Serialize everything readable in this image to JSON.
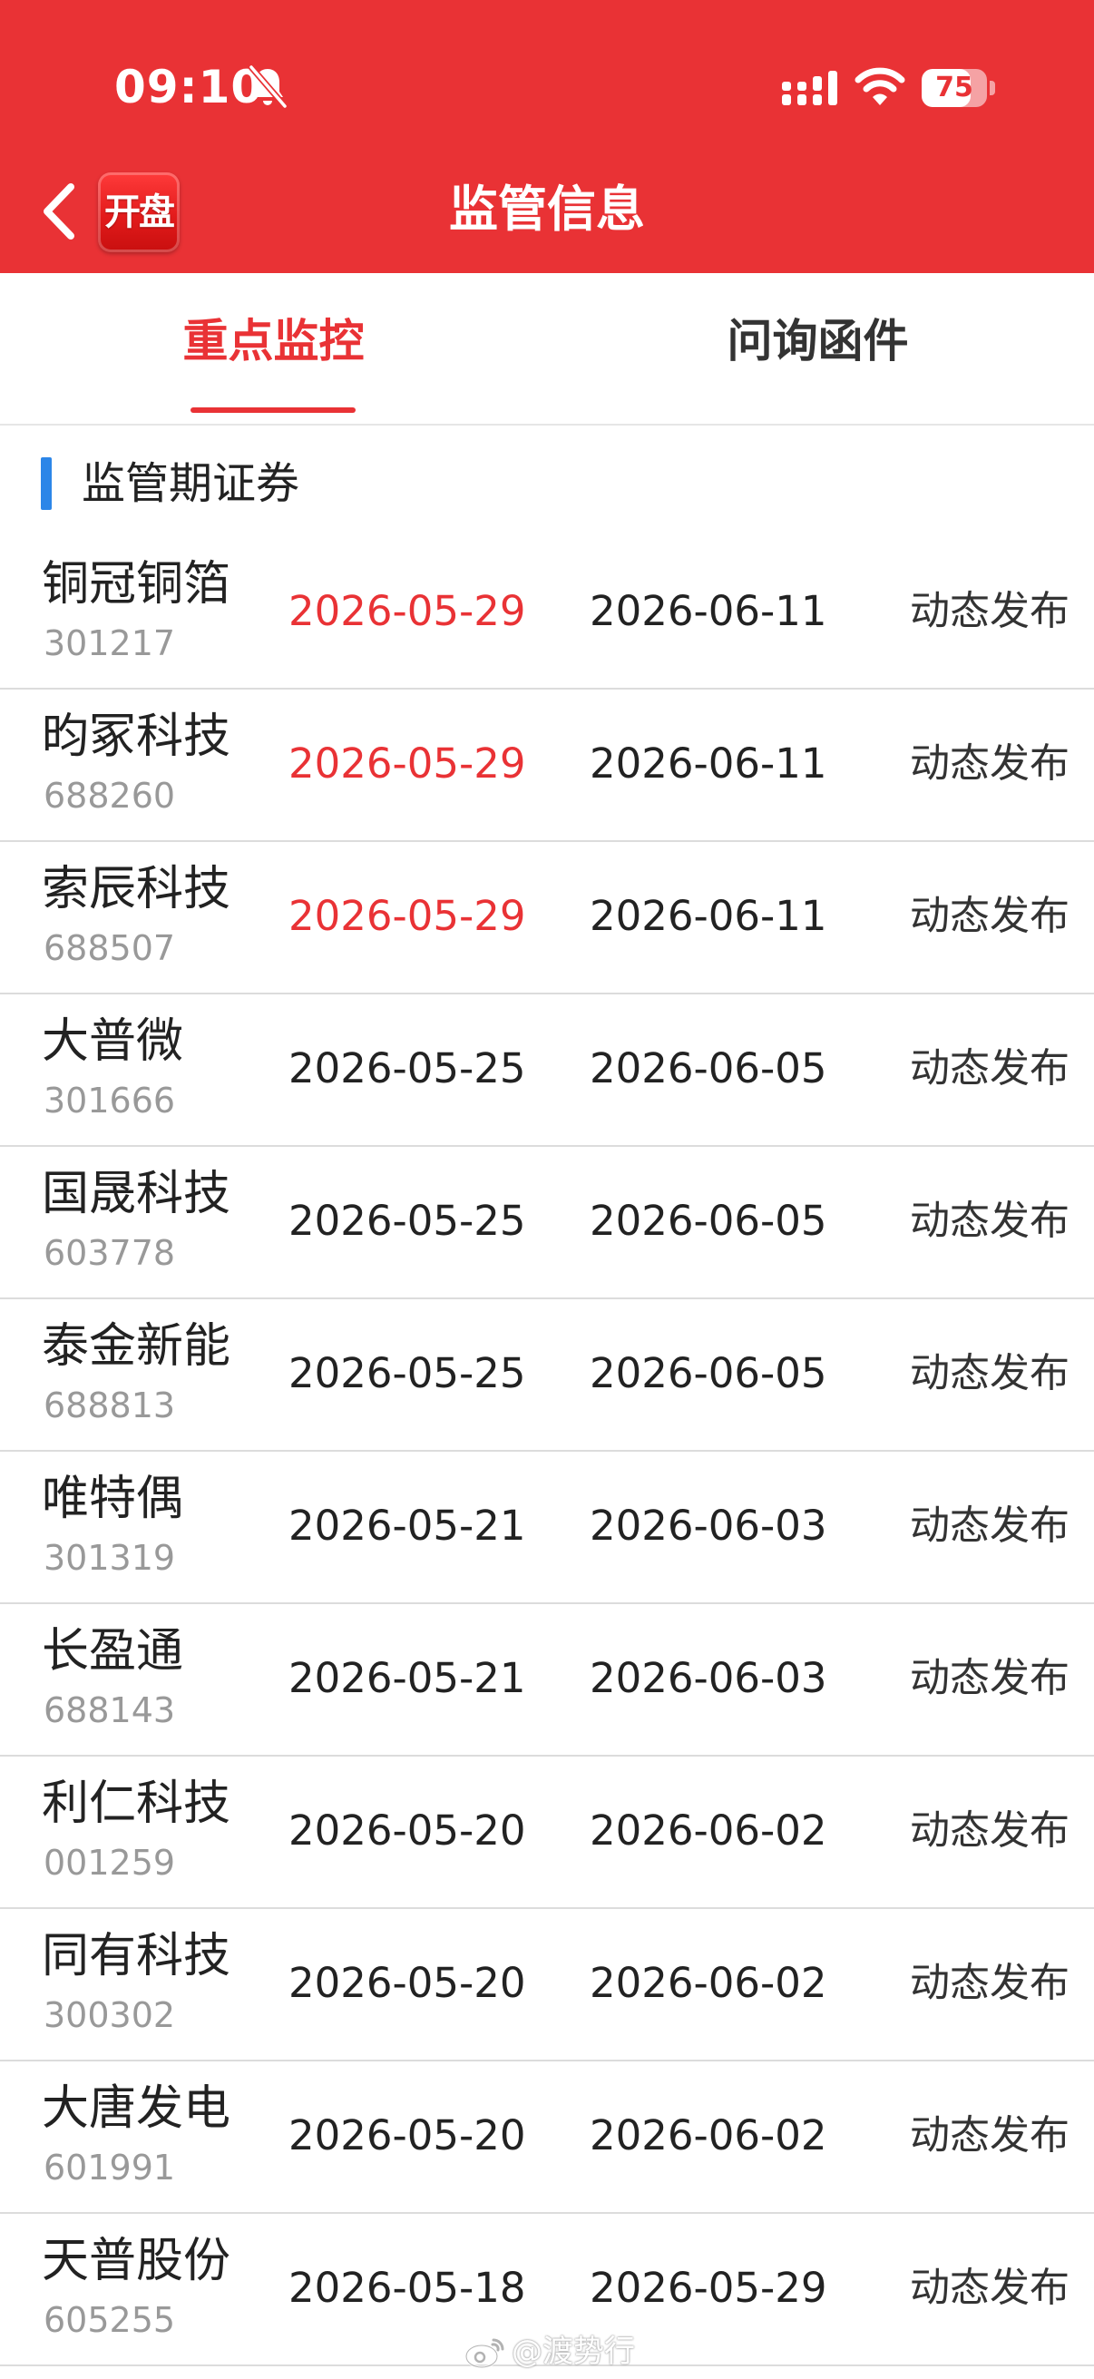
{
  "status_bar": {
    "time": "09:10",
    "battery": "75",
    "battery_level": 0.75,
    "icons": [
      "bell-slash-icon",
      "signal-icon",
      "wifi-icon",
      "battery-icon"
    ]
  },
  "nav": {
    "back_icon": "chevron-left-icon",
    "logo_text": "开盘",
    "title": "监管信息"
  },
  "tabs": [
    {
      "label": "重点监控",
      "active": true
    },
    {
      "label": "问询函件",
      "active": false
    }
  ],
  "section": {
    "title": "监管期证券"
  },
  "rows": [
    {
      "name": "铜冠铜箔",
      "code": "301217",
      "start": "2026-05-29",
      "end": "2026-06-11",
      "action": "动态发布",
      "start_highlight": true
    },
    {
      "name": "昀冢科技",
      "code": "688260",
      "start": "2026-05-29",
      "end": "2026-06-11",
      "action": "动态发布",
      "start_highlight": true
    },
    {
      "name": "索辰科技",
      "code": "688507",
      "start": "2026-05-29",
      "end": "2026-06-11",
      "action": "动态发布",
      "start_highlight": true
    },
    {
      "name": "大普微",
      "code": "301666",
      "start": "2026-05-25",
      "end": "2026-06-05",
      "action": "动态发布",
      "start_highlight": false
    },
    {
      "name": "国晟科技",
      "code": "603778",
      "start": "2026-05-25",
      "end": "2026-06-05",
      "action": "动态发布",
      "start_highlight": false
    },
    {
      "name": "泰金新能",
      "code": "688813",
      "start": "2026-05-25",
      "end": "2026-06-05",
      "action": "动态发布",
      "start_highlight": false
    },
    {
      "name": "唯特偶",
      "code": "301319",
      "start": "2026-05-21",
      "end": "2026-06-03",
      "action": "动态发布",
      "start_highlight": false
    },
    {
      "name": "长盈通",
      "code": "688143",
      "start": "2026-05-21",
      "end": "2026-06-03",
      "action": "动态发布",
      "start_highlight": false
    },
    {
      "name": "利仁科技",
      "code": "001259",
      "start": "2026-05-20",
      "end": "2026-06-02",
      "action": "动态发布",
      "start_highlight": false
    },
    {
      "name": "同有科技",
      "code": "300302",
      "start": "2026-05-20",
      "end": "2026-06-02",
      "action": "动态发布",
      "start_highlight": false
    },
    {
      "name": "大唐发电",
      "code": "601991",
      "start": "2026-05-20",
      "end": "2026-06-02",
      "action": "动态发布",
      "start_highlight": false
    },
    {
      "name": "天普股份",
      "code": "605255",
      "start": "2026-05-18",
      "end": "2026-05-29",
      "action": "动态发布",
      "start_highlight": false
    }
  ],
  "watermark": {
    "icon": "weibo-icon",
    "text": "@渡势行"
  },
  "colors": {
    "header_bg": "#e93235",
    "accent_red": "#e93235",
    "section_bar": "#2c86e8",
    "code_gray": "#999999",
    "divider": "#dcdcdc"
  }
}
